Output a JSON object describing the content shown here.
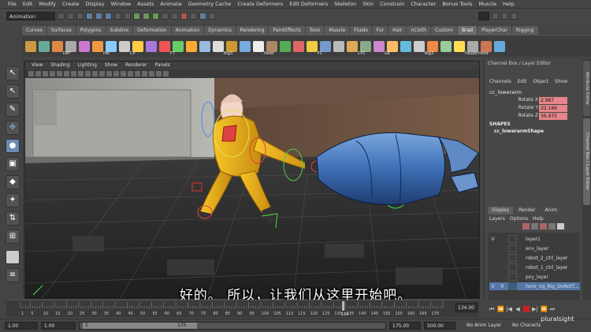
{
  "menubar": [
    "File",
    "Edit",
    "Modify",
    "Create",
    "Display",
    "Window",
    "Assets",
    "Animate",
    "Geometry Cache",
    "Create Deformers",
    "Edit Deformers",
    "Skeleton",
    "Skin",
    "Constrain",
    "Character",
    "Bonus Tools",
    "Muscle",
    "Help"
  ],
  "status_line": {
    "mode": "Animation"
  },
  "shelf_tabs": [
    "Curves",
    "Surfaces",
    "Polygons",
    "Subdivs",
    "Deformation",
    "Animation",
    "Dynamics",
    "Rendering",
    "PaintEffects",
    "Toon",
    "Muscle",
    "Fluids",
    "Fur",
    "Hair",
    "nCloth",
    "Custom",
    "Brad",
    "PlayerChar",
    "Rigging"
  ],
  "shelf_active_tab": "Brad",
  "shelf_icon_labels": [
    "DEF",
    "His",
    "CP",
    "FT",
    "Big3",
    "Parer",
    "FC",
    "CFC",
    "GE",
    "Big3",
    "Hsubd",
    "Hshd",
    "Fkvk",
    "UT"
  ],
  "viewport_menu": [
    "View",
    "Shading",
    "Lighting",
    "Show",
    "Renderer",
    "Panels"
  ],
  "channel_box": {
    "header": "Channel Box / Layer Editor",
    "menu": [
      "Channels",
      "Edit",
      "Object",
      "Show"
    ],
    "object": "cc_lowerarm",
    "channels": [
      {
        "label": "Rotate X",
        "value": "2.987"
      },
      {
        "label": "Rotate Y",
        "value": "32.166"
      },
      {
        "label": "Rotate Z",
        "value": "36.975"
      }
    ],
    "shapes_label": "SHAPES",
    "shape": "cc_lowerarmShape"
  },
  "side_tabs": [
    "Attribute Editor",
    "Channel Box / Layer Editor"
  ],
  "layer_editor": {
    "tabs": [
      "Display",
      "Render",
      "Anim"
    ],
    "menu": [
      "Layers",
      "Options",
      "Help"
    ],
    "layers": [
      {
        "v": "V",
        "name": "layer1"
      },
      {
        "v": "",
        "name": "env_layer"
      },
      {
        "v": "",
        "name": "robot_2_ctrl_layer"
      },
      {
        "v": "",
        "name": "robot_1_ctrl_layer"
      },
      {
        "v": "",
        "name": "pxy_layer"
      },
      {
        "v": "V",
        "name": "hero_rig_Rig_DoNotT..."
      }
    ]
  },
  "time_slider": {
    "ticks": [
      "1",
      "5",
      "10",
      "15",
      "20",
      "25",
      "30",
      "35",
      "40",
      "45",
      "50",
      "55",
      "60",
      "65",
      "70",
      "75",
      "80",
      "85",
      "90",
      "95",
      "100",
      "105",
      "110",
      "115",
      "120",
      "125",
      "130",
      "135",
      "140",
      "145",
      "150",
      "155",
      "160",
      "165",
      "170"
    ],
    "current_frame": "134",
    "current_frame_field": "134.00"
  },
  "range_slider": {
    "start": "1.00",
    "playback_start": "1.00",
    "range_left": "1",
    "range_right": "175",
    "playback_end": "175.00",
    "end": "500.00",
    "anim_layer": "No Anim Layer",
    "character": "No Character Set"
  },
  "subtitle": "好的。 所以，让我们从这里开始吧。",
  "watermark": "pluralsight"
}
